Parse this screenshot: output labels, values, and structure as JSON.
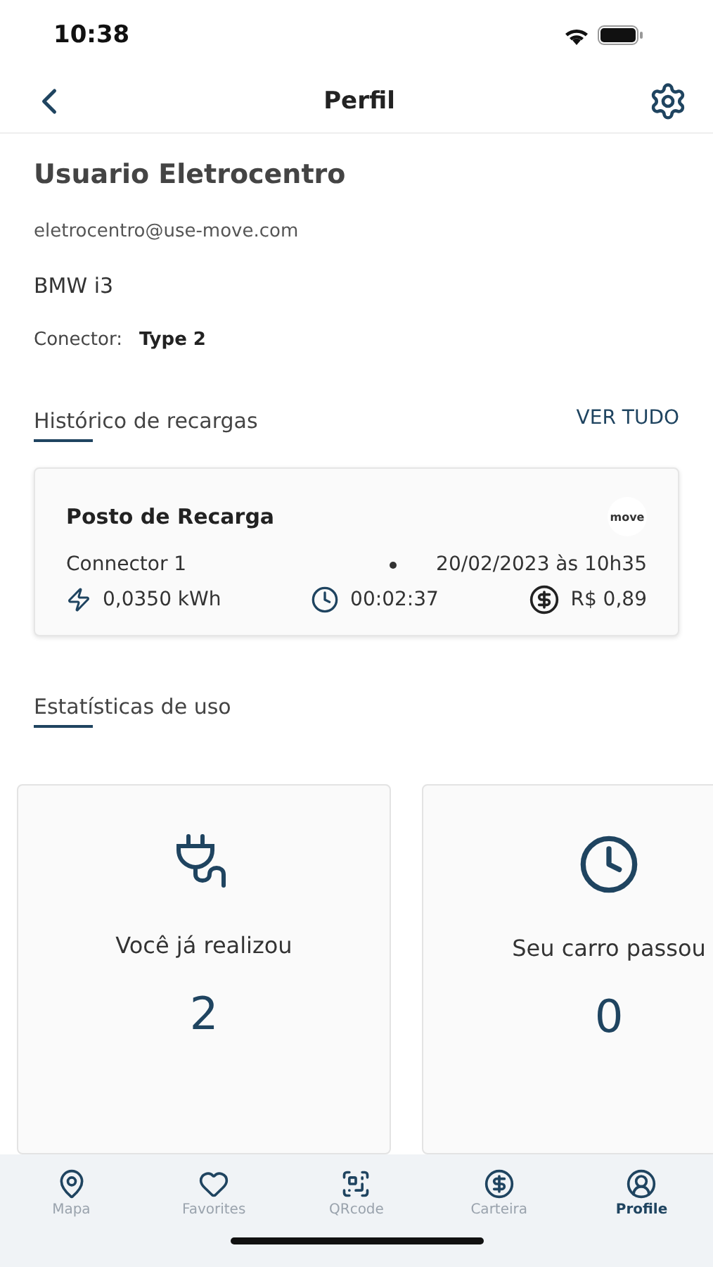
{
  "status_bar": {
    "time": "10:38"
  },
  "header": {
    "title": "Perfil"
  },
  "profile": {
    "name": "Usuario Eletrocentro",
    "email": "eletrocentro@use-move.com",
    "car": "BMW i3",
    "connector_label": "Conector:",
    "connector_value": "Type 2"
  },
  "history": {
    "title": "Histórico de recargas",
    "link": "VER TUDO",
    "card": {
      "station": "Posto de Recarga",
      "logo": "move",
      "connector": "Connector 1",
      "date": "20/02/2023 às 10h35",
      "energy": "0,0350 kWh",
      "duration": "00:02:37",
      "cost": "R$ 0,89"
    }
  },
  "stats": {
    "title": "Estatísticas de uso",
    "cards": [
      {
        "kind": "plug",
        "label": "Você já realizou",
        "value": "2"
      },
      {
        "kind": "clock",
        "label": "Seu carro passou",
        "value": "0"
      }
    ]
  },
  "tab_bar": [
    {
      "kind": "map",
      "label": "Mapa",
      "selected": false
    },
    {
      "kind": "heart",
      "label": "Favorites",
      "selected": false
    },
    {
      "kind": "qr",
      "label": "QRcode",
      "selected": false
    },
    {
      "kind": "wallet",
      "label": "Carteira",
      "selected": false
    },
    {
      "kind": "profile",
      "label": "Profile",
      "selected": true
    }
  ]
}
